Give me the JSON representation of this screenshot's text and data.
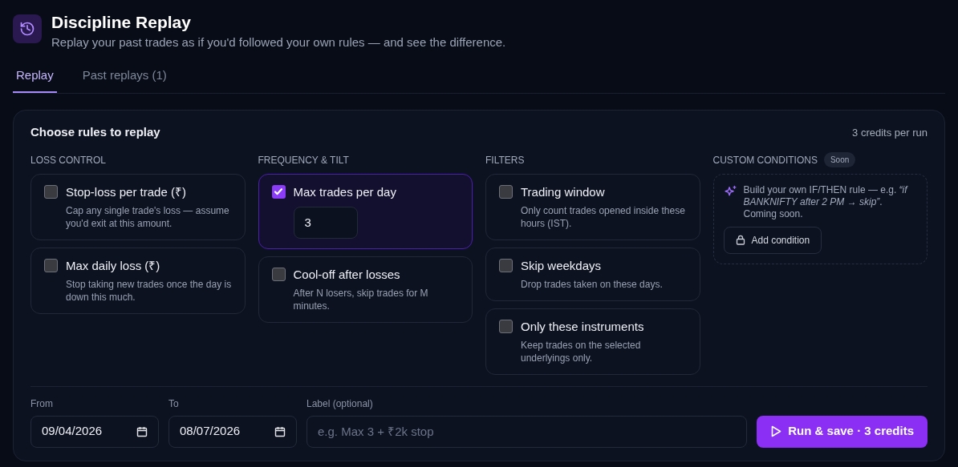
{
  "header": {
    "title": "Discipline Replay",
    "subtitle": "Replay your past trades as if you'd followed your own rules — and see the difference."
  },
  "tabs": [
    {
      "label": "Replay",
      "selected": true
    },
    {
      "label": "Past replays (1)",
      "selected": false
    }
  ],
  "rules_panel": {
    "title": "Choose rules to replay",
    "credits_note": "3 credits per run",
    "groups": [
      {
        "heading": "LOSS CONTROL",
        "rules": [
          {
            "title": "Stop-loss per trade (₹)",
            "description": "Cap any single trade's loss — assume you'd exit at this amount.",
            "checked": false
          },
          {
            "title": "Max daily loss (₹)",
            "description": "Stop taking new trades once the day is down this much.",
            "checked": false
          }
        ]
      },
      {
        "heading": "FREQUENCY & TILT",
        "rules": [
          {
            "title": "Max trades per day",
            "value": "3",
            "checked": true
          },
          {
            "title": "Cool-off after losses",
            "description": "After N losers, skip trades for M minutes.",
            "checked": false
          }
        ]
      },
      {
        "heading": "FILTERS",
        "rules": [
          {
            "title": "Trading window",
            "description": "Only count trades opened inside these hours (IST).",
            "checked": false
          },
          {
            "title": "Skip weekdays",
            "description": "Drop trades taken on these days.",
            "checked": false
          },
          {
            "title": "Only these instruments",
            "description": "Keep trades on the selected underlyings only.",
            "checked": false
          }
        ]
      }
    ],
    "custom": {
      "heading": "CUSTOM CONDITIONS",
      "badge": "Soon",
      "description": "Build your own IF/THEN rule — e.g. *“if BANKNIFTY after 2 PM → skip”*. Coming soon.",
      "button": "Add condition"
    }
  },
  "run_bar": {
    "from": {
      "label": "From",
      "value": "09/04/2026"
    },
    "to": {
      "label": "To",
      "value": "08/07/2026"
    },
    "name": {
      "label": "Label (optional)",
      "placeholder": "e.g. Max 3 + ₹2k stop"
    },
    "button": "Run & save · 3 credits"
  }
}
